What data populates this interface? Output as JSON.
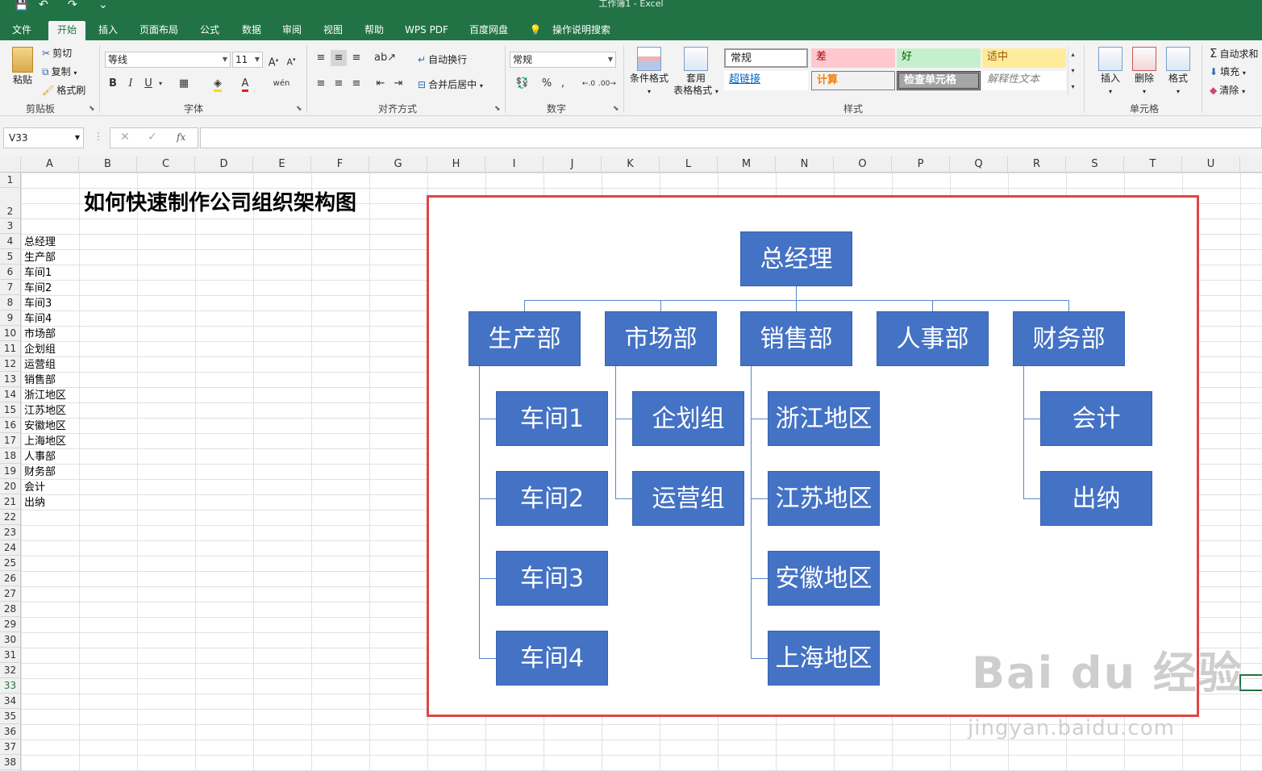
{
  "window": {
    "title": "工作簿1  -  Excel"
  },
  "tabs": [
    "文件",
    "开始",
    "插入",
    "页面布局",
    "公式",
    "数据",
    "审阅",
    "视图",
    "帮助",
    "WPS PDF",
    "百度网盘",
    "操作说明搜索"
  ],
  "ribbon": {
    "clipboard": {
      "paste": "粘贴",
      "cut": "剪切",
      "copy": "复制",
      "format_painter": "格式刷",
      "label": "剪贴板"
    },
    "font": {
      "name": "等线",
      "size": "11",
      "label": "字体",
      "bold": "B",
      "italic": "I",
      "underline": "U"
    },
    "alignment": {
      "wrap": "自动换行",
      "merge": "合并后居中",
      "label": "对齐方式"
    },
    "number": {
      "format": "常规",
      "label": "数字",
      "percent": "%"
    },
    "styles": {
      "conditional": "条件格式",
      "table_format_1": "套用",
      "table_format_2": "表格格式",
      "cells": [
        "常规",
        "差",
        "好",
        "适中",
        "超链接",
        "计算",
        "检查单元格",
        "解释性文本"
      ],
      "label": "样式"
    },
    "cells_group": {
      "insert": "插入",
      "delete": "删除",
      "format": "格式",
      "label": "单元格"
    },
    "editing": {
      "autosum": "自动求和",
      "fill": "填充",
      "clear": "清除"
    }
  },
  "formula_bar": {
    "name_box": "V33",
    "formula": "",
    "fx": "fx"
  },
  "columns": [
    "A",
    "B",
    "C",
    "D",
    "E",
    "F",
    "G",
    "H",
    "I",
    "J",
    "K",
    "L",
    "M",
    "N",
    "O",
    "P",
    "Q",
    "R",
    "S",
    "T",
    "U"
  ],
  "rows": [
    "1",
    "2",
    "3",
    "4",
    "5",
    "6",
    "7",
    "8",
    "9",
    "10",
    "11",
    "12",
    "13",
    "14",
    "15",
    "16",
    "17",
    "18",
    "19",
    "20",
    "21",
    "22",
    "23",
    "24",
    "25",
    "26",
    "27",
    "28",
    "29",
    "30",
    "31",
    "32",
    "33",
    "34",
    "35",
    "36",
    "37",
    "38"
  ],
  "sheet": {
    "title": "如何快速制作公司组织架构图",
    "list": [
      "总经理",
      "生产部",
      "车间1",
      "车间2",
      "车间3",
      "车间4",
      "市场部",
      "企划组",
      "运营组",
      "销售部",
      "浙江地区",
      "江苏地区",
      "安徽地区",
      "上海地区",
      "人事部",
      "财务部",
      "会计",
      "出纳"
    ]
  },
  "org_chart": {
    "root": "总经理",
    "departments": [
      {
        "name": "生产部",
        "children": [
          "车间1",
          "车间2",
          "车间3",
          "车间4"
        ]
      },
      {
        "name": "市场部",
        "children": [
          "企划组",
          "运营组"
        ]
      },
      {
        "name": "销售部",
        "children": [
          "浙江地区",
          "江苏地区",
          "安徽地区",
          "上海地区"
        ]
      },
      {
        "name": "人事部",
        "children": []
      },
      {
        "name": "财务部",
        "children": [
          "会计",
          "出纳"
        ]
      }
    ]
  },
  "watermark": {
    "main": "Bai du 经验",
    "sub": "jingyan.baidu.com"
  }
}
